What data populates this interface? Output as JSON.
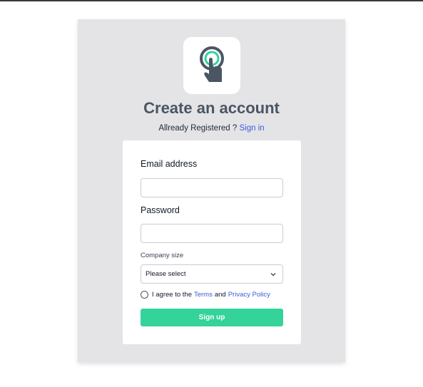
{
  "header": {
    "title": "Create an account",
    "subtitle_prefix": "Allready Registered ?",
    "signin_link": "Sign in"
  },
  "form": {
    "email_label": "Email address",
    "email_value": "",
    "password_label": "Password",
    "password_value": "",
    "company_size_label": "Company size",
    "company_size_selected": "Please select",
    "agree_prefix": "I agree to the",
    "terms_link": "Terms",
    "agree_and": "and",
    "privacy_link": "Privacy Policy",
    "submit_label": "Sign up"
  },
  "colors": {
    "accent": "#34d399",
    "link": "#3b5bdb",
    "panel": "#e4e4e7",
    "title": "#4b5563"
  },
  "icons": {
    "logo": "tap-hand-icon",
    "select": "chevron-down-icon"
  }
}
